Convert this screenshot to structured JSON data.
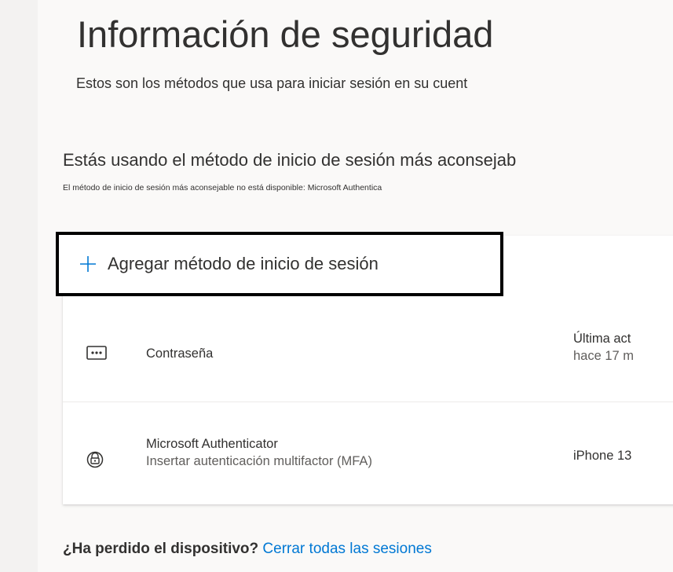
{
  "page": {
    "title": "Información de seguridad",
    "subtitle": "Estos son los métodos que usa para iniciar sesión en su cuent"
  },
  "recommendation": {
    "heading": "Estás usando el método de inicio de sesión más aconsejab",
    "note": "El método de inicio de sesión más aconsejable no está disponible: Microsoft Authentica"
  },
  "add_method": {
    "label": "Agregar método de inicio de sesión"
  },
  "methods": [
    {
      "icon": "password-dots-icon",
      "title": "Contraseña",
      "subtitle": "",
      "right_line1": "Última act",
      "right_line2": "hace 17 m"
    },
    {
      "icon": "authenticator-lock-icon",
      "title": "Microsoft Authenticator",
      "subtitle": "Insertar autenticación multifactor (MFA)",
      "right_line1": "iPhone 13",
      "right_line2": ""
    }
  ],
  "footer": {
    "question": "¿Ha perdido el dispositivo?",
    "link": "Cerrar todas las sesiones"
  },
  "colors": {
    "accent": "#0078d4",
    "text": "#323130",
    "muted": "#605e5c",
    "highlight_border": "#000000"
  }
}
